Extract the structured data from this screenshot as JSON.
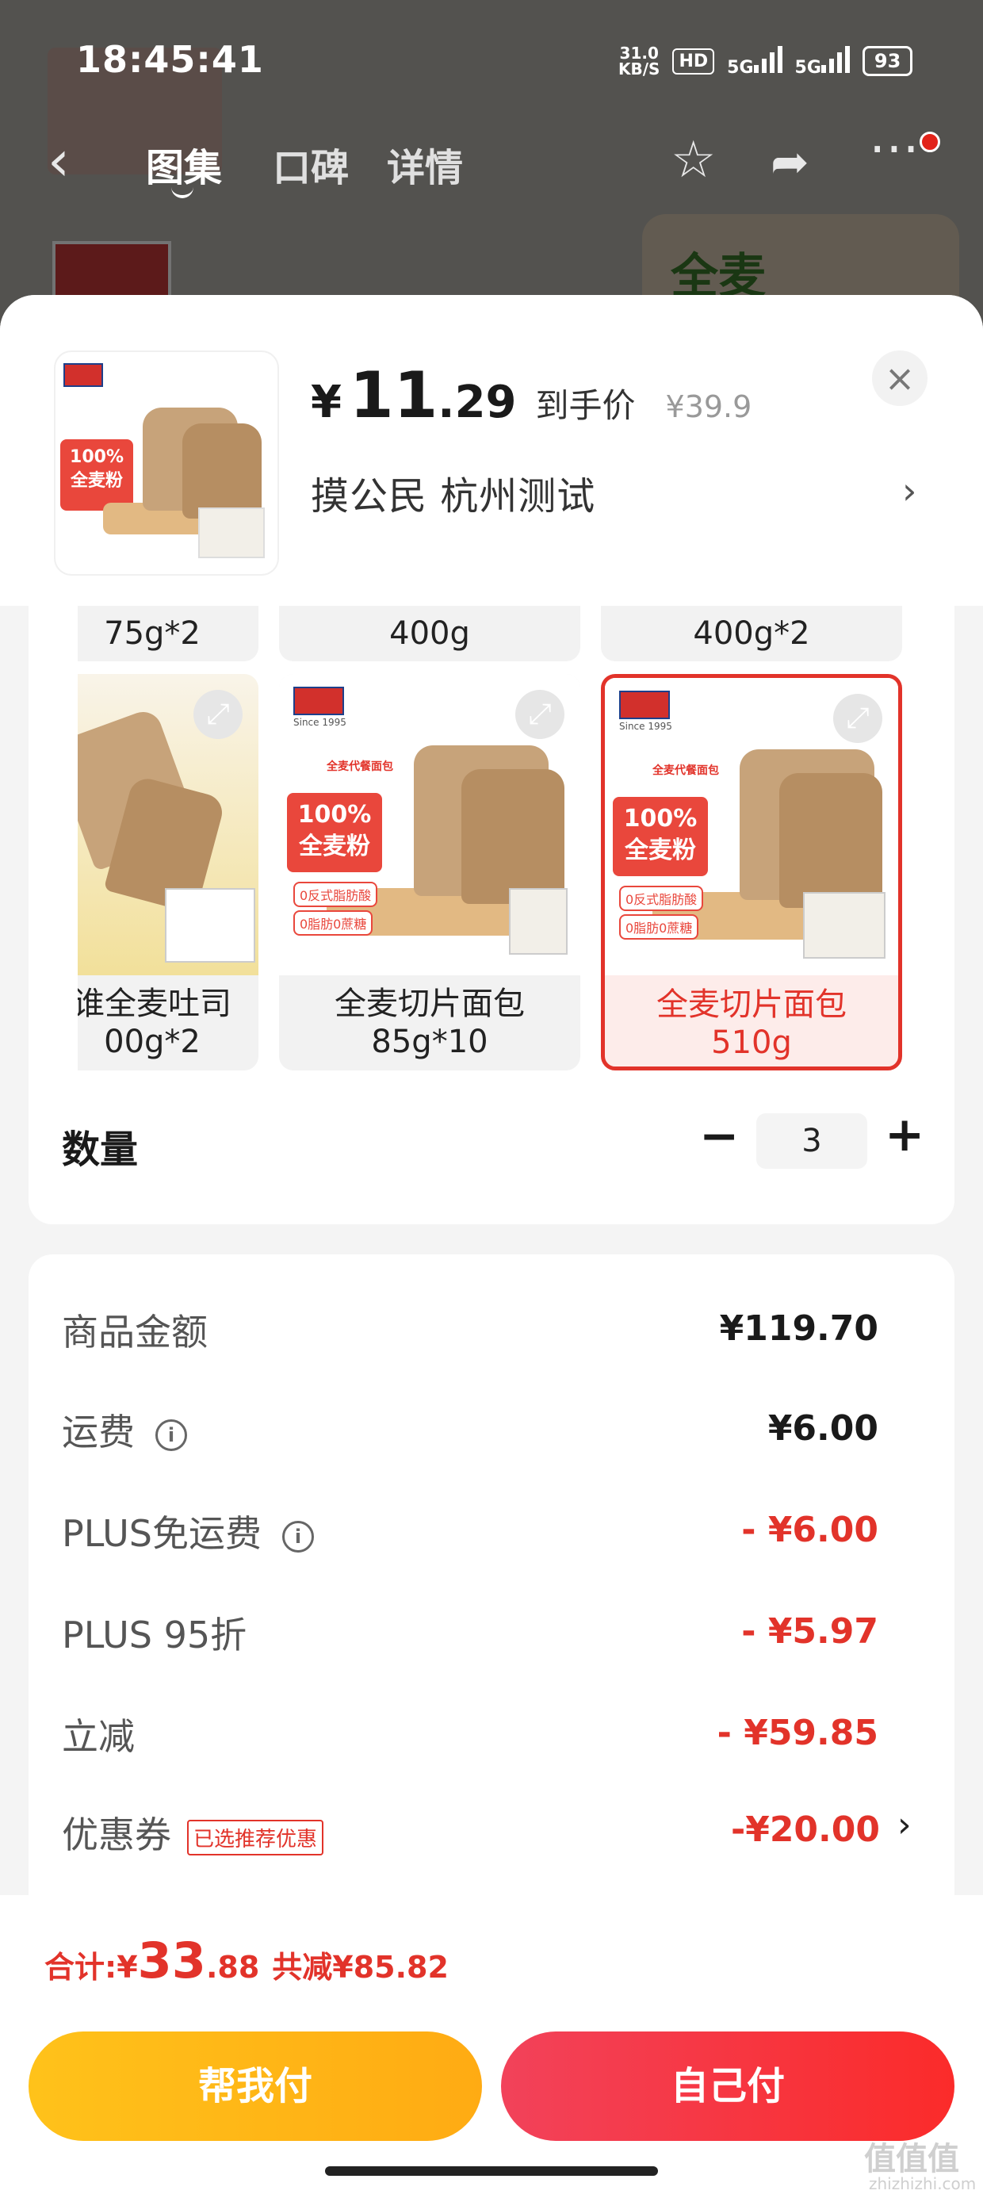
{
  "status_bar": {
    "time": "18:45:41",
    "net_speed_value": "31.0",
    "net_speed_unit": "KB/S",
    "hd": "HD",
    "sig1": "5G",
    "sig2": "5G",
    "battery": "93"
  },
  "background": {
    "tabs": [
      "图集",
      "口碑",
      "详情"
    ],
    "card_text": "全麦"
  },
  "header": {
    "currency": "¥",
    "price_int": "11",
    "price_dec": ".29",
    "price_tag": "到手价",
    "original_price": "¥39.9",
    "address": "摸公民  杭州测试"
  },
  "variants": {
    "top_row": [
      "75g*2",
      "400g",
      "400g*2"
    ],
    "cards": [
      {
        "line1": "谁全麦吐司",
        "line2": "00g*2",
        "selected": false
      },
      {
        "line1": "全麦切片面包",
        "line2": "85g*10",
        "selected": false
      },
      {
        "line1": "全麦切片面包",
        "line2": "510g",
        "selected": true
      }
    ],
    "badge_line1": "100%",
    "badge_line2": "全麦粉",
    "logo_since": "Since 1995",
    "tag_line1": "0反式脂肪酸",
    "tag_line2": "0脂肪0蔗糖",
    "pack_title": "全麦代餐面包"
  },
  "quantity": {
    "label": "数量",
    "value": "3",
    "minus": "−",
    "plus": "+"
  },
  "summary": {
    "rows": [
      {
        "label": "商品金额",
        "value": "¥119.70",
        "red": false
      },
      {
        "label": "运费",
        "value": "¥6.00",
        "red": false
      },
      {
        "label": "PLUS免运费",
        "value": "- ¥6.00",
        "red": true
      },
      {
        "label": "PLUS 95折",
        "value": "- ¥5.97",
        "red": true
      },
      {
        "label": "立减",
        "value": "- ¥59.85",
        "red": true
      },
      {
        "label": "优惠券",
        "value": "-¥20.00",
        "red": true
      }
    ],
    "coupon_tag": "已选推荐优惠"
  },
  "footer": {
    "total_label": "合计: ",
    "total_cny": "¥",
    "total_int": "33",
    "total_dec": ".88",
    "total_save": "共减¥85.82",
    "btn_friend": "帮我付",
    "btn_self": "自己付"
  },
  "watermark": {
    "main": "值值值",
    "sub": "zhizhizhi.com"
  },
  "colors": {
    "accent_red": "#e2332a",
    "friend_btn": "#ffb915",
    "self_btn": "#f7353f"
  }
}
